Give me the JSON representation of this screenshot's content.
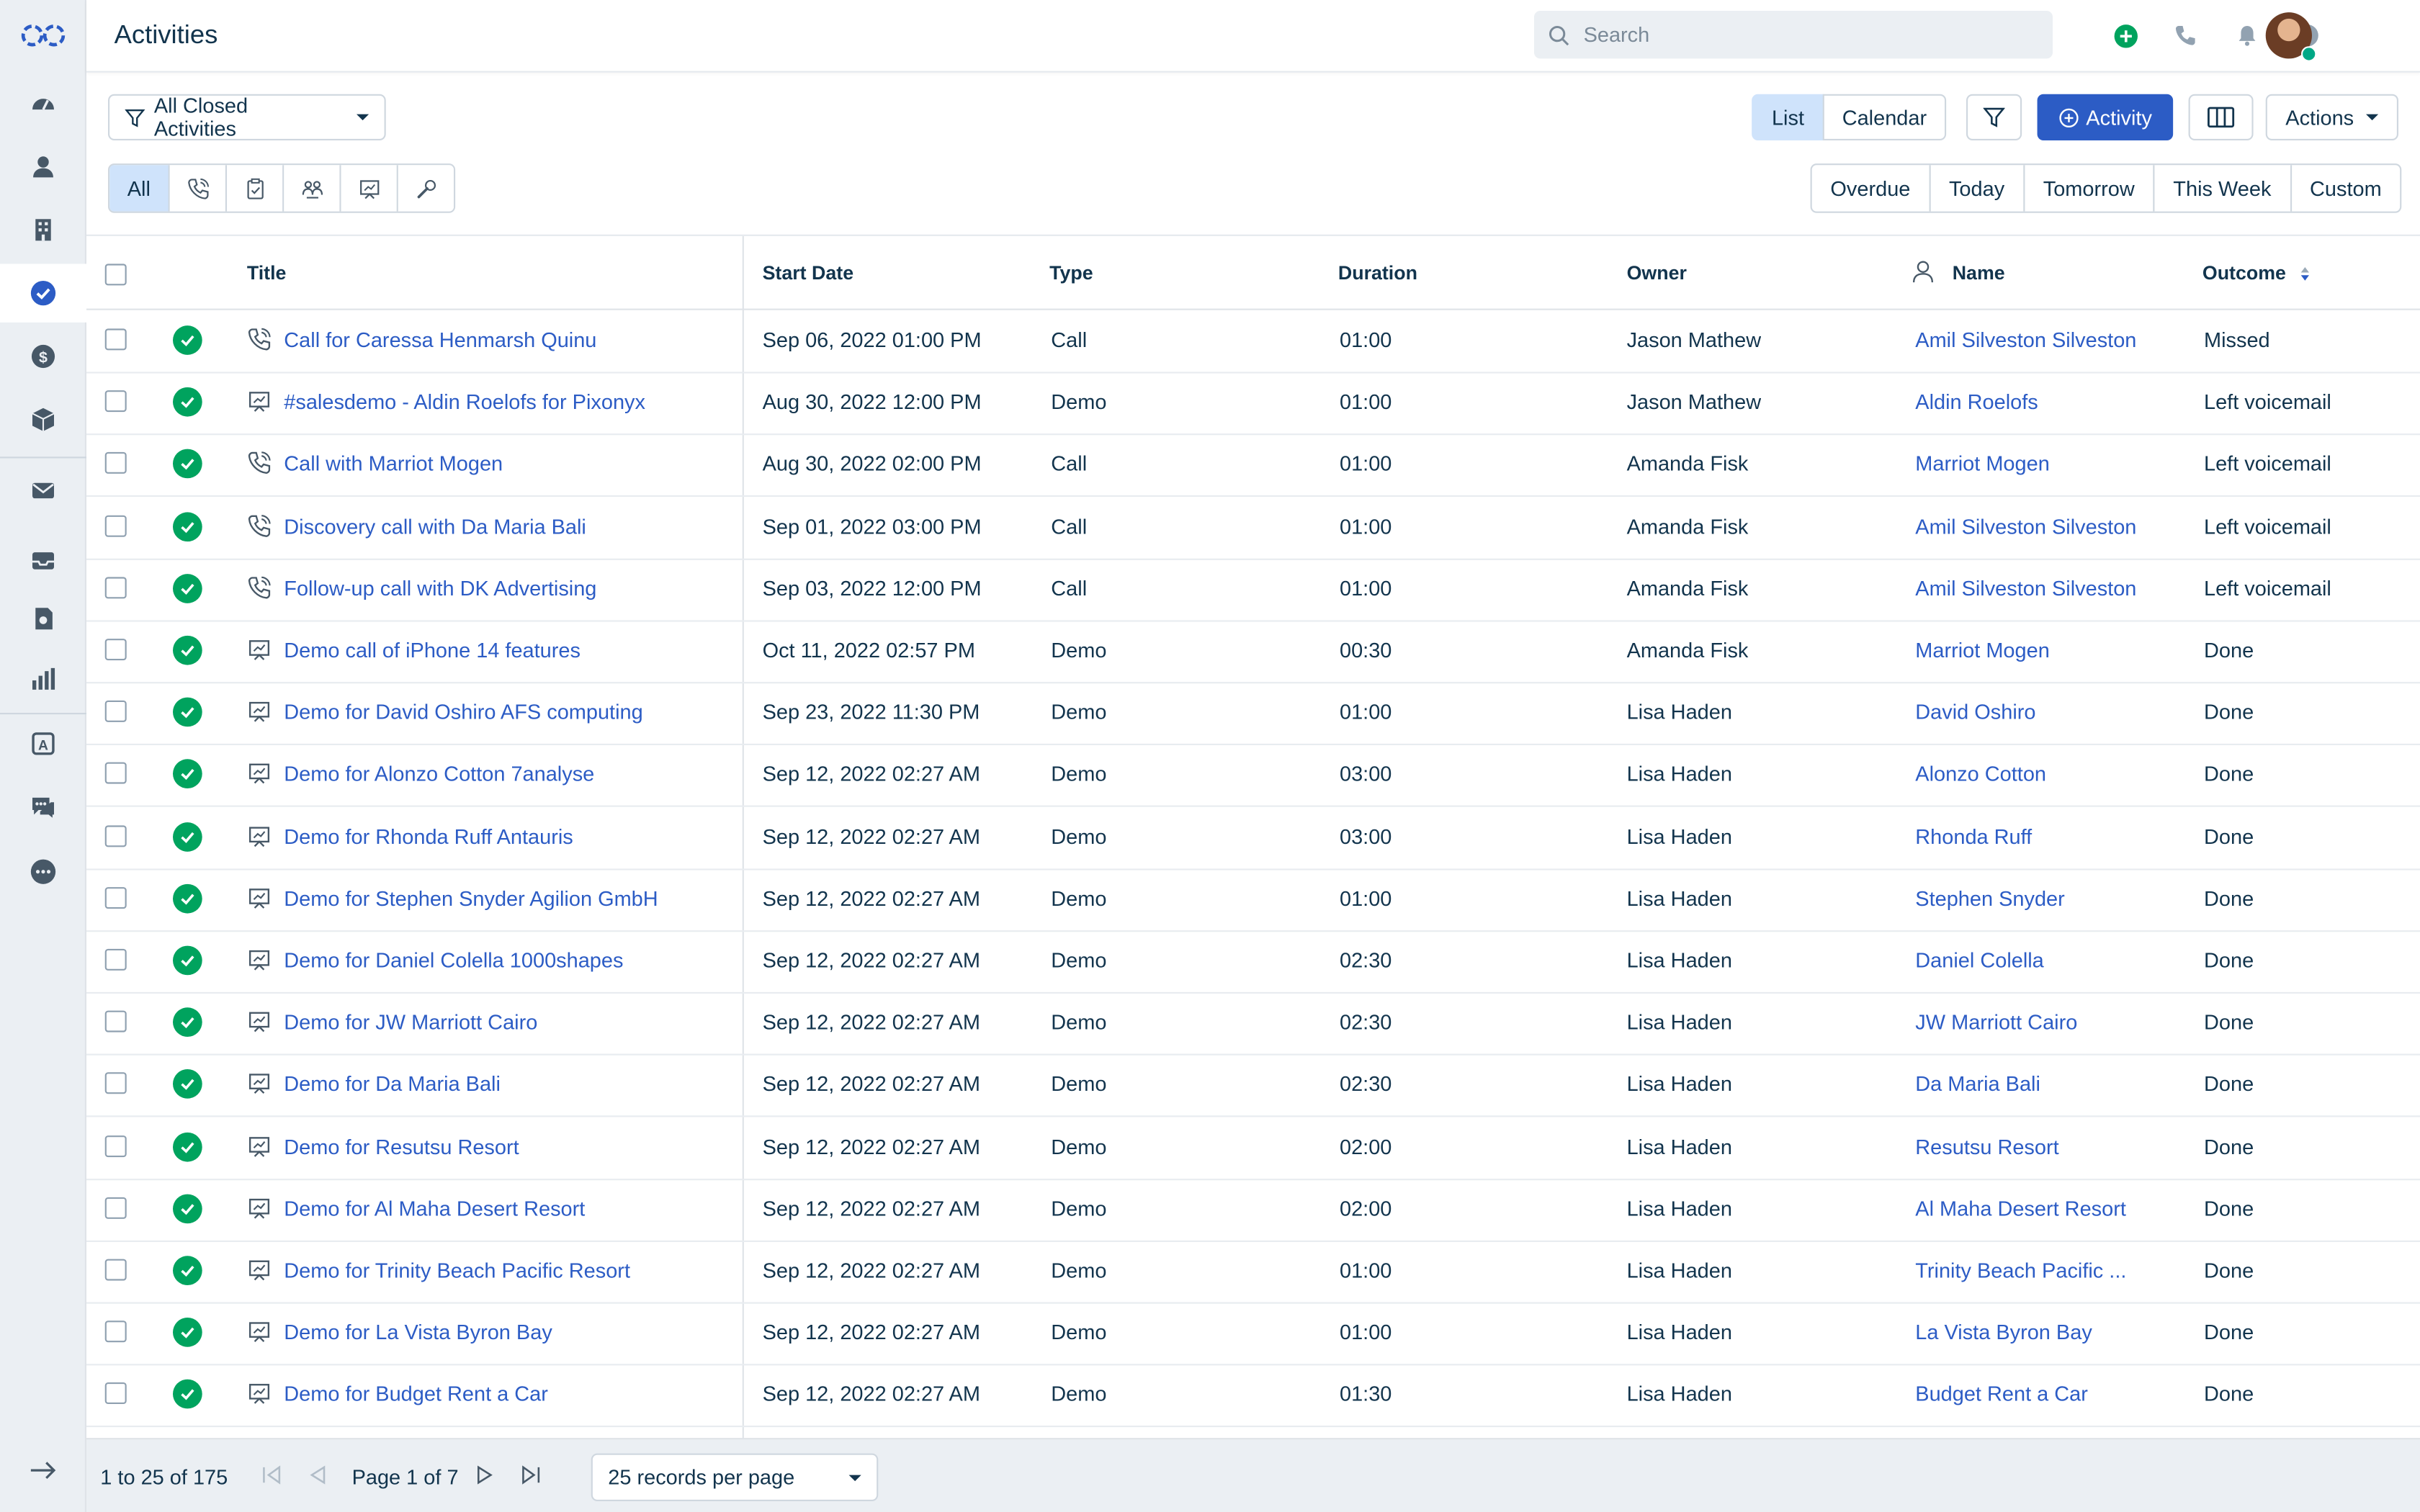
{
  "header": {
    "title": "Activities",
    "search_placeholder": "Search"
  },
  "toolbar": {
    "view_filter": "All Closed Activities",
    "view_list": "List",
    "view_calendar": "Calendar",
    "add_activity": "Activity",
    "actions": "Actions"
  },
  "type_tabs": {
    "all": "All",
    "icons": [
      "phone-icon",
      "task-icon",
      "meeting-icon",
      "demo-icon",
      "tool-icon"
    ]
  },
  "date_filters": [
    "Overdue",
    "Today",
    "Tomorrow",
    "This Week",
    "Custom"
  ],
  "table": {
    "columns": {
      "title": "Title",
      "start_date": "Start Date",
      "type": "Type",
      "duration": "Duration",
      "owner": "Owner",
      "name": "Name",
      "outcome": "Outcome"
    },
    "rows": [
      {
        "icon": "phone",
        "title": "Call for Caressa Henmarsh Quinu",
        "start": "Sep 06, 2022 01:00 PM",
        "type": "Call",
        "duration": "01:00",
        "owner": "Jason Mathew",
        "name": "Amil Silveston Silveston",
        "outcome": "Missed"
      },
      {
        "icon": "demo",
        "title": "#salesdemo - Aldin Roelofs for Pixonyx",
        "start": "Aug 30, 2022 12:00 PM",
        "type": "Demo",
        "duration": "01:00",
        "owner": "Jason Mathew",
        "name": "Aldin Roelofs",
        "outcome": "Left voicemail"
      },
      {
        "icon": "phone",
        "title": "Call with Marriot Mogen",
        "start": "Aug 30, 2022 02:00 PM",
        "type": "Call",
        "duration": "01:00",
        "owner": "Amanda Fisk",
        "name": "Marriot Mogen",
        "outcome": "Left voicemail"
      },
      {
        "icon": "phone",
        "title": "Discovery call with Da Maria Bali",
        "start": "Sep 01, 2022 03:00 PM",
        "type": "Call",
        "duration": "01:00",
        "owner": "Amanda Fisk",
        "name": "Amil Silveston Silveston",
        "outcome": "Left voicemail"
      },
      {
        "icon": "phone",
        "title": "Follow-up call with DK Advertising",
        "start": "Sep 03, 2022 12:00 PM",
        "type": "Call",
        "duration": "01:00",
        "owner": "Amanda Fisk",
        "name": "Amil Silveston Silveston",
        "outcome": "Left voicemail"
      },
      {
        "icon": "demo",
        "title": "Demo call of iPhone 14 features",
        "start": "Oct 11, 2022 02:57 PM",
        "type": "Demo",
        "duration": "00:30",
        "owner": "Amanda Fisk",
        "name": "Marriot Mogen",
        "outcome": "Done"
      },
      {
        "icon": "demo",
        "title": "Demo for David Oshiro AFS computing",
        "start": "Sep 23, 2022 11:30 PM",
        "type": "Demo",
        "duration": "01:00",
        "owner": "Lisa Haden",
        "name": "David Oshiro",
        "outcome": "Done"
      },
      {
        "icon": "demo",
        "title": "Demo for Alonzo Cotton 7analyse",
        "start": "Sep 12, 2022 02:27 AM",
        "type": "Demo",
        "duration": "03:00",
        "owner": "Lisa Haden",
        "name": "Alonzo Cotton",
        "outcome": "Done"
      },
      {
        "icon": "demo",
        "title": "Demo for Rhonda Ruff Antauris",
        "start": "Sep 12, 2022 02:27 AM",
        "type": "Demo",
        "duration": "03:00",
        "owner": "Lisa Haden",
        "name": "Rhonda Ruff",
        "outcome": "Done"
      },
      {
        "icon": "demo",
        "title": "Demo for Stephen Snyder Agilion GmbH",
        "start": "Sep 12, 2022 02:27 AM",
        "type": "Demo",
        "duration": "01:00",
        "owner": "Lisa Haden",
        "name": "Stephen Snyder",
        "outcome": "Done"
      },
      {
        "icon": "demo",
        "title": "Demo for Daniel Colella 1000shapes",
        "start": "Sep 12, 2022 02:27 AM",
        "type": "Demo",
        "duration": "02:30",
        "owner": "Lisa Haden",
        "name": "Daniel Colella",
        "outcome": "Done"
      },
      {
        "icon": "demo",
        "title": "Demo for JW Marriott Cairo",
        "start": "Sep 12, 2022 02:27 AM",
        "type": "Demo",
        "duration": "02:30",
        "owner": "Lisa Haden",
        "name": "JW Marriott Cairo",
        "outcome": "Done"
      },
      {
        "icon": "demo",
        "title": "Demo for Da Maria Bali",
        "start": "Sep 12, 2022 02:27 AM",
        "type": "Demo",
        "duration": "02:30",
        "owner": "Lisa Haden",
        "name": "Da Maria Bali",
        "outcome": "Done"
      },
      {
        "icon": "demo",
        "title": "Demo for Resutsu Resort",
        "start": "Sep 12, 2022 02:27 AM",
        "type": "Demo",
        "duration": "02:00",
        "owner": "Lisa Haden",
        "name": "Resutsu Resort",
        "outcome": "Done"
      },
      {
        "icon": "demo",
        "title": "Demo for Al Maha Desert Resort",
        "start": "Sep 12, 2022 02:27 AM",
        "type": "Demo",
        "duration": "02:00",
        "owner": "Lisa Haden",
        "name": "Al Maha Desert Resort",
        "outcome": "Done"
      },
      {
        "icon": "demo",
        "title": "Demo for Trinity Beach Pacific Resort",
        "start": "Sep 12, 2022 02:27 AM",
        "type": "Demo",
        "duration": "01:00",
        "owner": "Lisa Haden",
        "name": "Trinity Beach Pacific ...",
        "outcome": "Done"
      },
      {
        "icon": "demo",
        "title": "Demo for La Vista Byron Bay",
        "start": "Sep 12, 2022 02:27 AM",
        "type": "Demo",
        "duration": "01:00",
        "owner": "Lisa Haden",
        "name": "La Vista Byron Bay",
        "outcome": "Done"
      },
      {
        "icon": "demo",
        "title": "Demo for Budget Rent a Car",
        "start": "Sep 12, 2022 02:27 AM",
        "type": "Demo",
        "duration": "01:30",
        "owner": "Lisa Haden",
        "name": "Budget Rent a Car",
        "outcome": "Done"
      }
    ]
  },
  "footer": {
    "range": "1 to 25 of 175",
    "page": "Page 1 of 7",
    "per_page": "25 records per page"
  },
  "colors": {
    "accent": "#2c5cc5",
    "done": "#00a35e",
    "sidebar_bg": "#ebeff3",
    "selected_bg": "#cfe3fb"
  }
}
